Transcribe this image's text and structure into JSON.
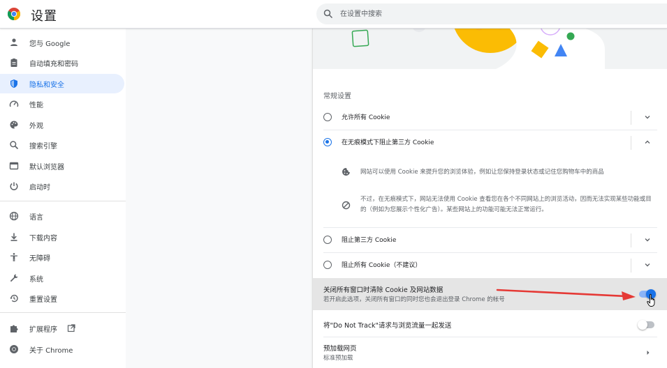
{
  "app": {
    "title": "设置"
  },
  "search": {
    "placeholder": "在设置中搜索"
  },
  "sidebar": {
    "items": [
      {
        "label": "您与 Google"
      },
      {
        "label": "自动填充和密码"
      },
      {
        "label": "隐私和安全"
      },
      {
        "label": "性能"
      },
      {
        "label": "外观"
      },
      {
        "label": "搜索引擎"
      },
      {
        "label": "默认浏览器"
      },
      {
        "label": "启动时"
      },
      {
        "label": "语言"
      },
      {
        "label": "下载内容"
      },
      {
        "label": "无障碍"
      },
      {
        "label": "系统"
      },
      {
        "label": "重置设置"
      },
      {
        "label": "扩展程序"
      },
      {
        "label": "关于 Chrome"
      }
    ],
    "active_index": 2
  },
  "cookies": {
    "section_label": "常规设置",
    "options": [
      {
        "label": "允许所有 Cookie",
        "selected": false
      },
      {
        "label": "在无痕模式下阻止第三方 Cookie",
        "selected": true
      },
      {
        "label": "阻止第三方 Cookie",
        "selected": false
      },
      {
        "label": "阻止所有 Cookie（不建议）",
        "selected": false
      }
    ],
    "details": [
      {
        "icon": "cookie-icon",
        "text": "网站可以使用 Cookie 来提升您的浏览体验，例如让您保持登录状态或记住您购物车中的商品"
      },
      {
        "icon": "block-icon",
        "text": "不过，在无痕模式下，网站无法使用 Cookie 查看您在各个不同网站上的浏览活动，因而无法实现某些功能或目的（例如为您展示个性化广告）。某些网站上的功能可能无法正常运行。"
      }
    ]
  },
  "clear_on_exit": {
    "title": "关闭所有窗口时清除 Cookie 及网站数据",
    "subtitle": "若开启此选项，关闭所有窗口的同时您也会退出登录 Chrome 的帐号",
    "enabled": true
  },
  "do_not_track": {
    "title": "将\"Do Not Track\"请求与浏览流量一起发送",
    "enabled": false
  },
  "preload": {
    "title": "预加载网页",
    "subtitle": "标准预加载"
  },
  "colors": {
    "accent": "#1a73e8",
    "annotation_arrow": "#e53935"
  }
}
